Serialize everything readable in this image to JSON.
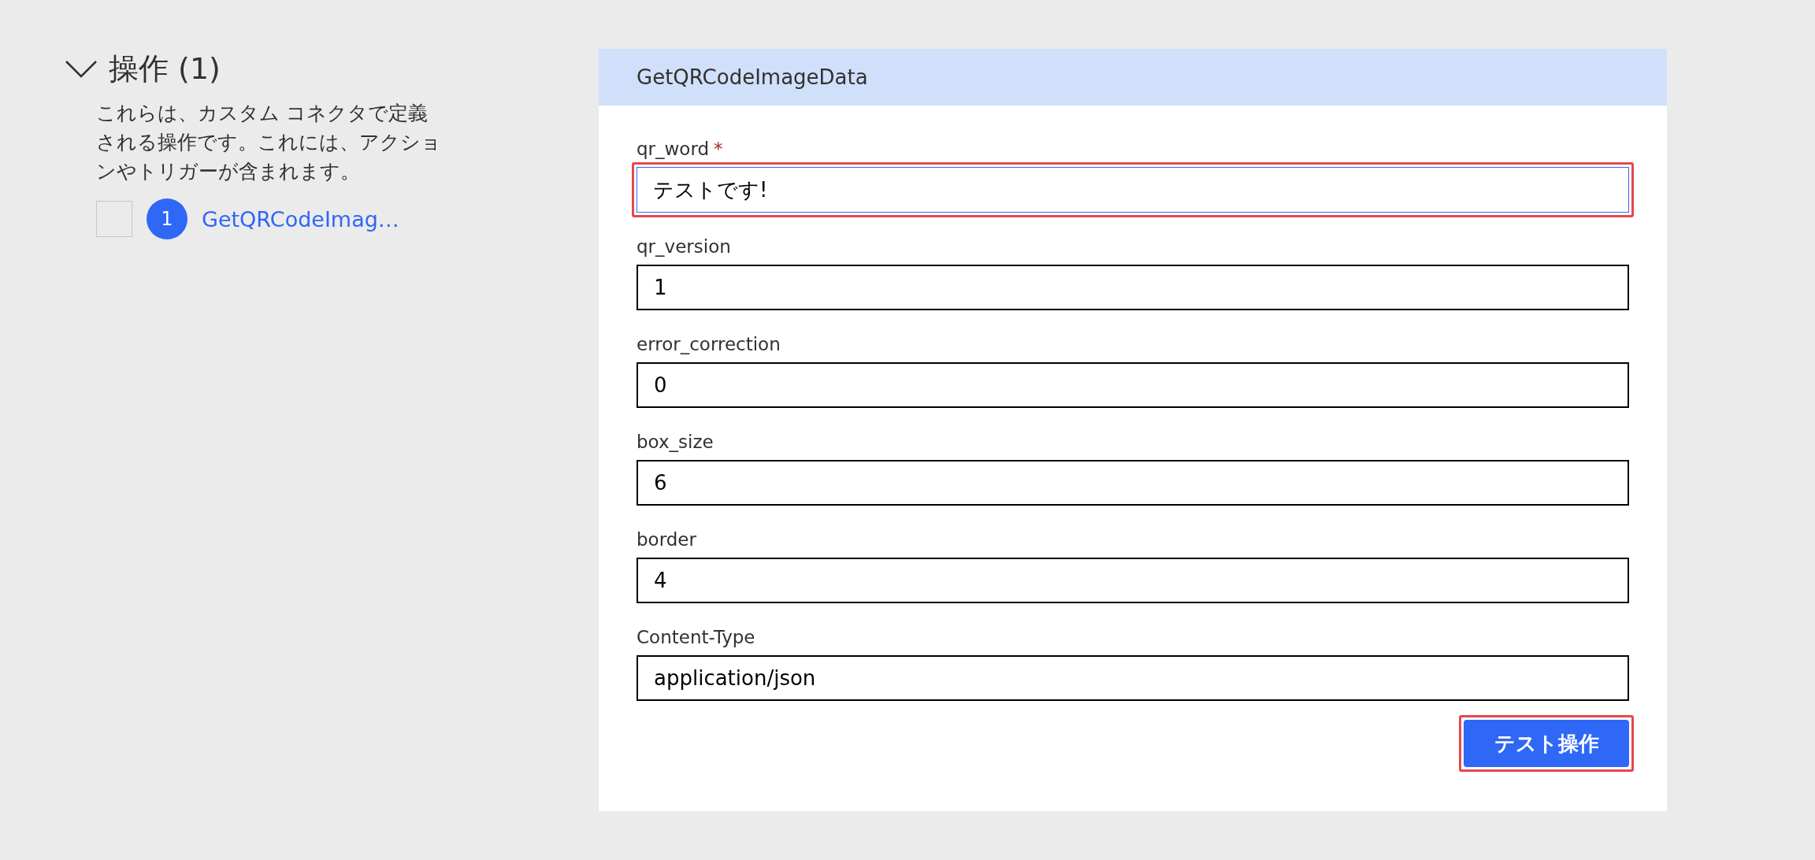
{
  "operations": {
    "title": "操作 (1)",
    "expanded": true,
    "description": "これらは、カスタム コネクタで定義される操作です。これには、アクションやトリガーが含まれます。",
    "items": [
      {
        "number": "1",
        "name": "GetQRCodeImag…",
        "checked": false
      }
    ]
  },
  "form": {
    "title": "GetQRCodeImageData",
    "fields": [
      {
        "label": "qr_word",
        "required_mark": "*",
        "value": "テストです!",
        "focused": true,
        "highlighted": true
      },
      {
        "label": "qr_version",
        "value": "1",
        "focused": false,
        "highlighted": false
      },
      {
        "label": "error_correction",
        "value": "0",
        "focused": false,
        "highlighted": false
      },
      {
        "label": "box_size",
        "value": "6",
        "focused": false,
        "highlighted": false
      },
      {
        "label": "border",
        "value": "4",
        "focused": false,
        "highlighted": false
      },
      {
        "label": "Content-Type",
        "value": "application/json",
        "focused": false,
        "highlighted": false
      }
    ],
    "button": {
      "label": "テスト操作",
      "highlighted": true
    }
  }
}
